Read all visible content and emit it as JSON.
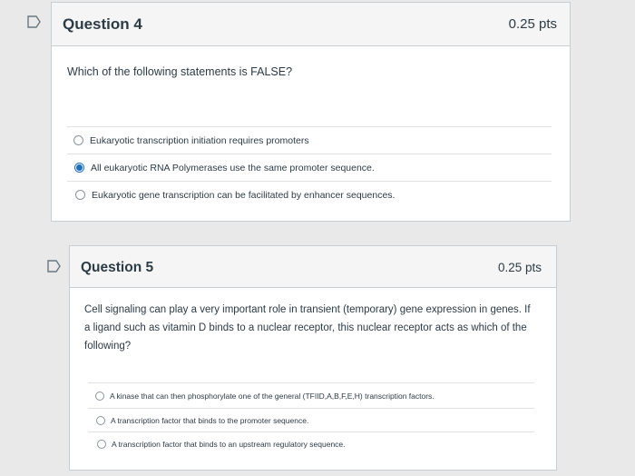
{
  "question4": {
    "title": "Question 4",
    "points": "0.25 pts",
    "prompt": "Which of the following statements is FALSE?",
    "answers": [
      {
        "label": "Eukaryotic transcription initiation requires promoters",
        "selected": false
      },
      {
        "label": "All eukaryotic RNA Polymerases use the same promoter sequence.",
        "selected": true
      },
      {
        "label": "Eukaryotic gene transcription can be facilitated by enhancer sequences.",
        "selected": false
      }
    ]
  },
  "question5": {
    "title": "Question 5",
    "points": "0.25 pts",
    "prompt": "Cell signaling can play a very important role in transient (temporary) gene expression in genes. If a ligand such as vitamin D binds to a nuclear receptor, this nuclear receptor acts as which of the following?",
    "answers": [
      {
        "label": "A kinase that can then phosphorylate one of the general (TFIID,A,B,F,E,H) transcription factors.",
        "selected": false
      },
      {
        "label": "A transcription factor that binds to the promoter sequence.",
        "selected": false
      },
      {
        "label": "A transcription factor that binds to an upstream regulatory sequence.",
        "selected": false
      }
    ]
  },
  "colors": {
    "background": "#e9e9e9",
    "card": "#ffffff",
    "header": "#f5f5f5",
    "border": "#c7cdd1",
    "selected_radio": "#1c6fb8"
  }
}
